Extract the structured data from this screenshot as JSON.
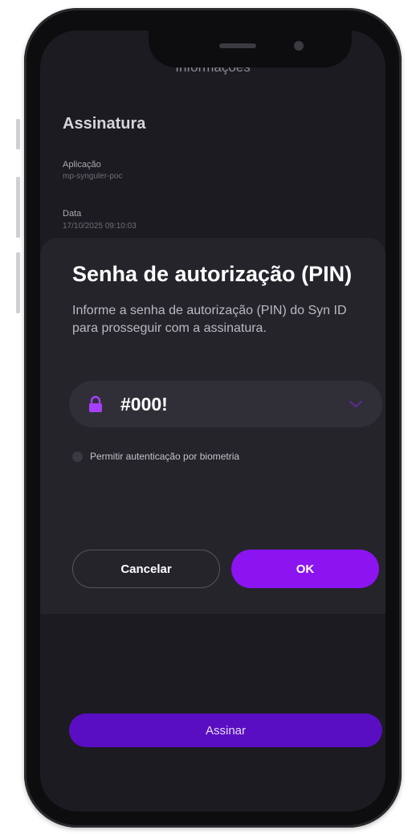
{
  "screen": {
    "top_title": "Informações"
  },
  "info": {
    "section_title": "Assinatura",
    "app_label": "Aplicação",
    "app_value": "mp-synguler-poc",
    "date_label": "Data",
    "date_value": "17/10/2025 09:10:03"
  },
  "dialog": {
    "title": "Senha de autorização (PIN)",
    "description": "Informe a senha de autorização (PIN) do Syn ID para prosseguir com a assinatura.",
    "pin_value": "#000!",
    "biometric_label": "Permitir autenticação por biometria",
    "cancel_label": "Cancelar",
    "ok_label": "OK"
  },
  "footer": {
    "sign_label": "Assinar"
  },
  "colors": {
    "accent": "#8b14f0",
    "sign_button": "#5a0ec2",
    "background": "#1c1b21",
    "dialog": "#25242b"
  },
  "icons": {
    "pin": "lock-icon",
    "dropdown": "chevron-down-icon"
  }
}
